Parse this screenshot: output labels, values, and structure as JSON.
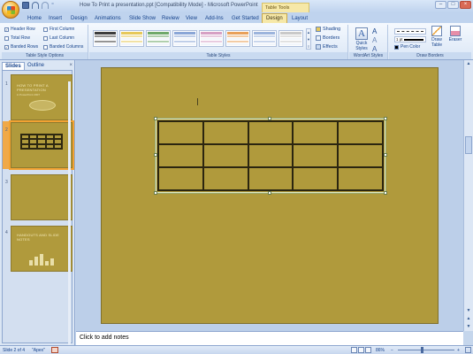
{
  "window": {
    "title": "How To Print a presentation.ppt [Compatibility Mode] - Microsoft PowerPoint",
    "contextual_tab_group": "Table Tools",
    "controls": [
      "–",
      "□",
      "×"
    ]
  },
  "qat": {
    "more_label": "⁼"
  },
  "ribbon_tabs": [
    "Home",
    "Insert",
    "Design",
    "Animations",
    "Slide Show",
    "Review",
    "View",
    "Add-Ins",
    "Get Started",
    "Design",
    "Layout"
  ],
  "ribbon": {
    "table_style_options": {
      "label": "Table Style Options",
      "options": [
        {
          "label": "Header Row",
          "checked": true
        },
        {
          "label": "First Column",
          "checked": false
        },
        {
          "label": "Total Row",
          "checked": false
        },
        {
          "label": "Last Column",
          "checked": false
        },
        {
          "label": "Banded Rows",
          "checked": true
        },
        {
          "label": "Banded Columns",
          "checked": false
        }
      ]
    },
    "table_styles": {
      "label": "Table Styles",
      "swatch_colors": [
        "#3c3c3c",
        "#e6c85a",
        "#6fa86a",
        "#8aa6d6",
        "#d6a0c4",
        "#e8a05a",
        "#9cb4dc",
        "#c9c9c9"
      ],
      "shading_label": "Shading",
      "borders_label": "Borders",
      "effects_label": "Effects"
    },
    "wordart_styles": {
      "label": "WordArt Styles",
      "quick_styles_label": "Quick Styles",
      "glyph": "A"
    },
    "draw_borders": {
      "label": "Draw Borders",
      "pen_weight": "1 pt",
      "pen_color_label": "Pen Color",
      "draw_table_label": "Draw Table",
      "eraser_label": "Eraser"
    }
  },
  "slides_pane": {
    "tabs": [
      "Slides",
      "Outline"
    ],
    "close_glyph": "×",
    "thumbnails": [
      {
        "number": "1",
        "title": "HOW TO PRINT A PRESENTATION",
        "subtitle": "in PowerPoint 2007"
      },
      {
        "number": "2",
        "title": "",
        "subtitle": ""
      },
      {
        "number": "3",
        "title": "",
        "subtitle": ""
      },
      {
        "number": "4",
        "title": "HANDOUTS AND SLIDE NOTES",
        "subtitle": ""
      }
    ],
    "selected_slide": 2
  },
  "slide": {
    "background": "#b09a3c",
    "table": {
      "rows": 3,
      "columns": 5
    }
  },
  "notes": {
    "placeholder": "Click to add notes"
  },
  "status_bar": {
    "slide_info": "Slide 2 of 4",
    "theme": "\"Apex\"",
    "zoom": "86%",
    "zoom_minus": "−",
    "zoom_plus": "+"
  },
  "scroll": {
    "up": "▲",
    "down": "▼",
    "prev": "▲",
    "next": "▼"
  }
}
